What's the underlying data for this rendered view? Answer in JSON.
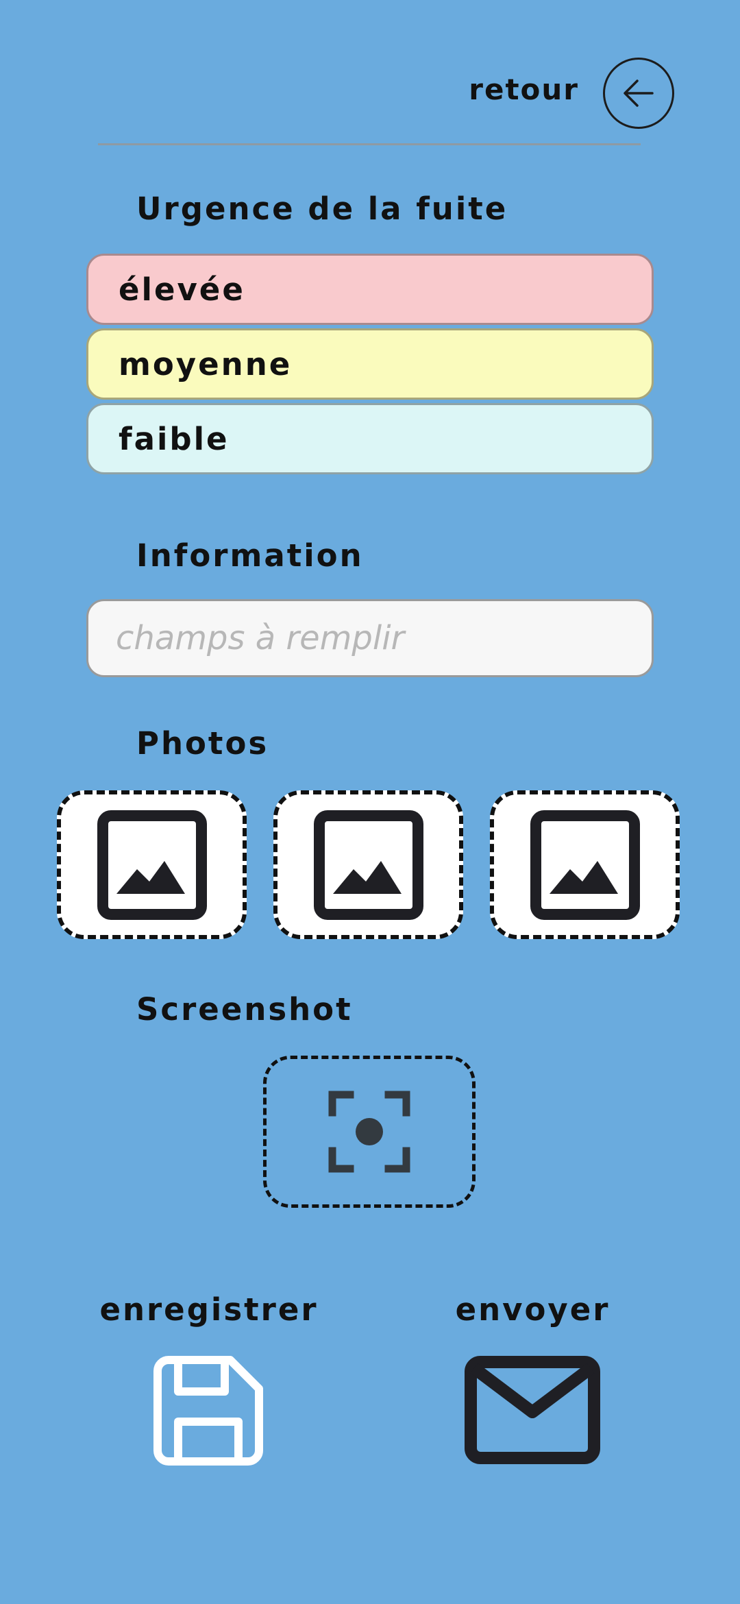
{
  "header": {
    "back_label": "retour"
  },
  "urgency": {
    "title": "Urgence de la fuite",
    "options": [
      {
        "label": "élevée",
        "color": "#f9cacd"
      },
      {
        "label": "moyenne",
        "color": "#fafbbd"
      },
      {
        "label": "faible",
        "color": "#dcf6f6"
      }
    ]
  },
  "information": {
    "title": "Information",
    "placeholder": "champs à remplir",
    "value": ""
  },
  "photos": {
    "title": "Photos",
    "slots": [
      {
        "icon": "image-icon"
      },
      {
        "icon": "image-icon"
      },
      {
        "icon": "image-icon"
      }
    ]
  },
  "screenshot": {
    "title": "Screenshot",
    "icon": "camera-focus-icon"
  },
  "actions": {
    "save_label": "enregistrer",
    "save_icon": "save-icon",
    "send_label": "envoyer",
    "send_icon": "mail-icon"
  },
  "colors": {
    "background": "#6aabde",
    "text": "#111111",
    "urgency_high": "#f9cacd",
    "urgency_medium": "#fafbbd",
    "urgency_low": "#dcf6f6"
  }
}
